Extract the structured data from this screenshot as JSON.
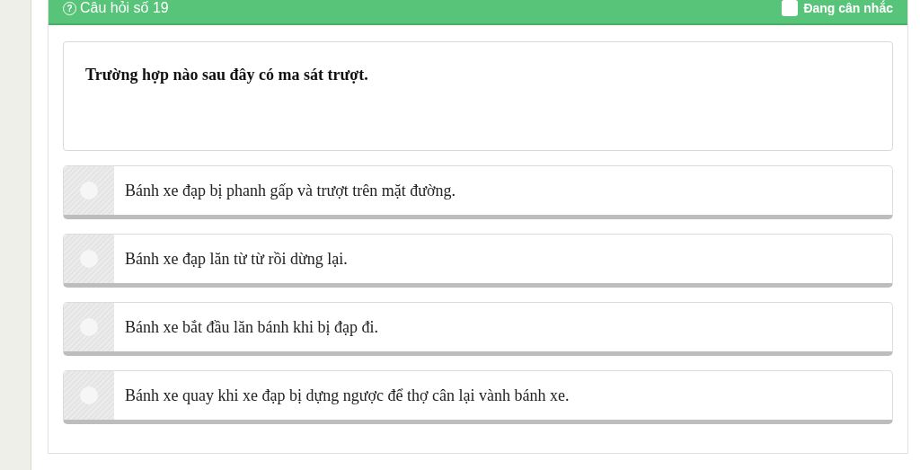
{
  "header": {
    "icon": "?",
    "title": "Câu hỏi số 19",
    "flag": {
      "label": "Đang cân nhắc",
      "checked": false
    }
  },
  "question": "Trường hợp nào sau đây có ma sát trượt.",
  "options": [
    {
      "text": "Bánh xe đạp bị phanh gấp và trượt trên mặt đường.",
      "selected": false
    },
    {
      "text": "Bánh xe đạp lăn từ từ rồi dừng lại.",
      "selected": false
    },
    {
      "text": "Bánh xe bắt đầu lăn bánh khi bị đạp đi.",
      "selected": false
    },
    {
      "text": "Bánh xe quay khi xe đạp bị dựng ngược để thợ cân lại vành bánh xe.",
      "selected": false
    }
  ]
}
